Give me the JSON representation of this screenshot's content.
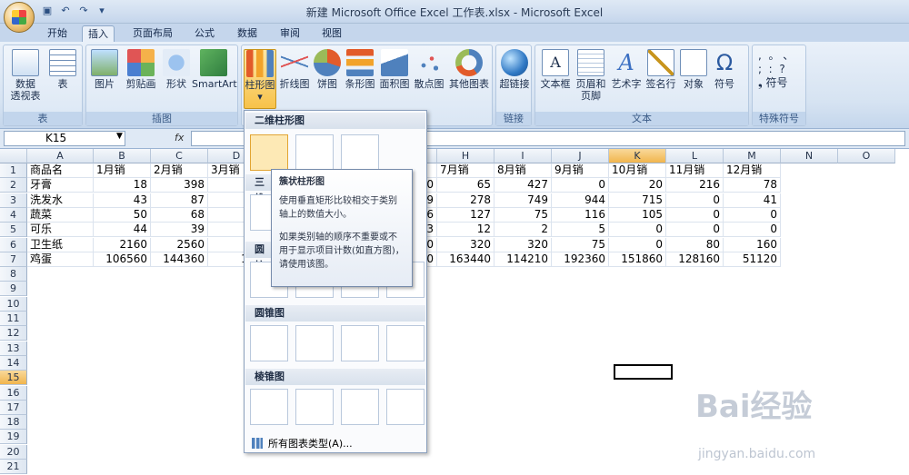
{
  "window": {
    "title": "新建 Microsoft Office Excel 工作表.xlsx - Microsoft Excel"
  },
  "tabs": [
    "开始",
    "插入",
    "页面布局",
    "公式",
    "数据",
    "审阅",
    "视图"
  ],
  "ribbon": {
    "pivot": "数据\n透视表",
    "table": "表",
    "group_table": "表",
    "picture": "图片",
    "clipart": "剪贴画",
    "shapes": "形状",
    "smartart": "SmartArt",
    "group_illust": "插图",
    "column": "柱形图",
    "line": "折线图",
    "pie": "饼图",
    "bar": "条形图",
    "area": "面积图",
    "scatter": "散点图",
    "other": "其他图表",
    "hyperlink": "超链接",
    "group_link": "链接",
    "textbox": "文本框",
    "header": "页眉和\n页脚",
    "wordart": "艺术字",
    "signature": "签名行",
    "object": "对象",
    "symbol": "符号",
    "group_text": "文本",
    "special_symbol": "符号",
    "group_special": "特殊符号"
  },
  "namebox": "K15",
  "fx": "fx",
  "columns": [
    "A",
    "B",
    "C",
    "D",
    "E",
    "F",
    "G",
    "H",
    "I",
    "J",
    "K",
    "L",
    "M",
    "N",
    "O"
  ],
  "rows": [
    "1",
    "2",
    "3",
    "4",
    "5",
    "6",
    "7",
    "8",
    "9",
    "10",
    "11",
    "12",
    "13",
    "14",
    "15",
    "16",
    "17",
    "18",
    "19",
    "20",
    "21"
  ],
  "cells": {
    "r1": [
      "商品名",
      "1月销",
      "2月销",
      "3月销",
      "",
      "",
      "",
      "7月销",
      "8月销",
      "9月销",
      "10月销",
      "11月销",
      "12月销"
    ],
    "r2": [
      "牙膏",
      "18",
      "398",
      "",
      "",
      "",
      "40",
      "65",
      "427",
      "0",
      "20",
      "216",
      "78"
    ],
    "r3": [
      "洗发水",
      "43",
      "87",
      "",
      "",
      "",
      "59",
      "278",
      "749",
      "944",
      "715",
      "0",
      "41"
    ],
    "r4": [
      "蔬菜",
      "50",
      "68",
      "",
      "",
      "",
      "76",
      "127",
      "75",
      "116",
      "105",
      "0",
      "0"
    ],
    "r5": [
      "可乐",
      "44",
      "39",
      "",
      "",
      "",
      "53",
      "12",
      "2",
      "5",
      "0",
      "0",
      "0"
    ],
    "r6": [
      "卫生纸",
      "2160",
      "2560",
      "",
      "",
      "",
      "20",
      "320",
      "320",
      "75",
      "0",
      "80",
      "160"
    ],
    "r7": [
      "鸡蛋",
      "106560",
      "144360",
      "104",
      "",
      "",
      "60",
      "163440",
      "114210",
      "192360",
      "151860",
      "128160",
      "51120"
    ]
  },
  "dropdown": {
    "sec1": "二维柱形图",
    "sec2": "三维",
    "sec3": "圆柱",
    "sec4": "圆锥图",
    "sec5": "棱锥图",
    "all": "所有图表类型(A)..."
  },
  "tooltip": {
    "title": "簇状柱形图",
    "p1": "使用垂直矩形比较相交于类别轴上的数值大小。",
    "p2": "如果类别轴的顺序不重要或不用于显示项目计数(如直方图)，请使用该图。"
  },
  "watermark": {
    "main": "Bai经验",
    "sub": "jingyan.baidu.com"
  }
}
